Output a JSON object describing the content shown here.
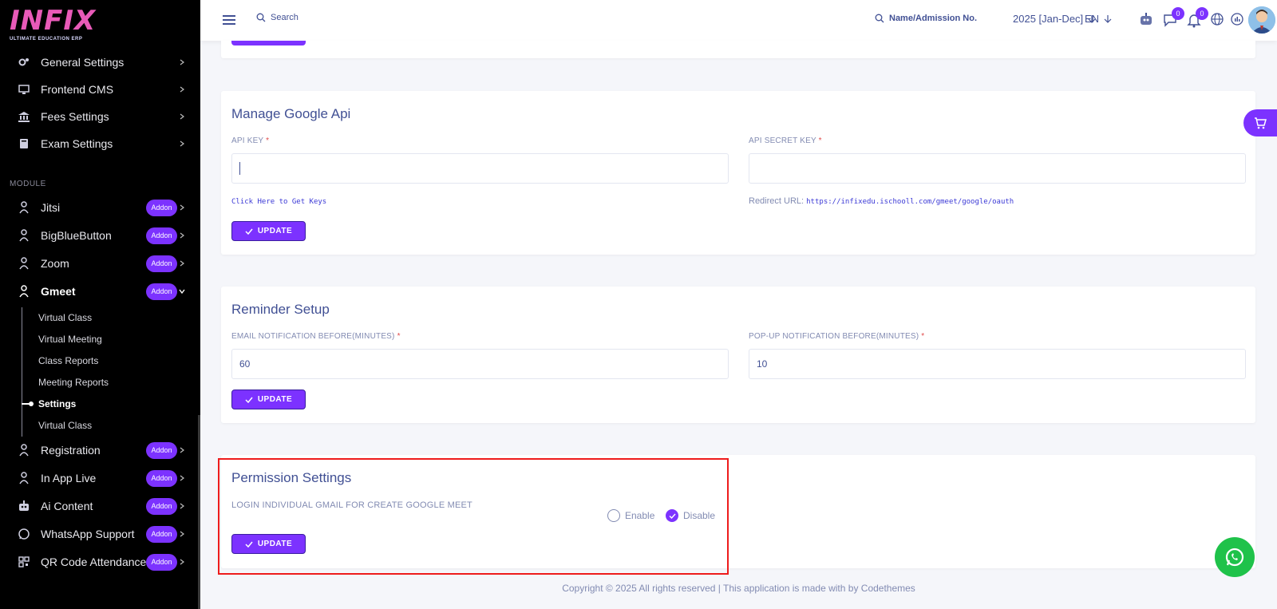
{
  "brand": {
    "logo_text": "INFIX",
    "logo_sub": "ULTIMATE EDUCATION ERP"
  },
  "sidebar": {
    "top_items": [
      {
        "label": "General Settings",
        "icon": "gears-icon"
      },
      {
        "label": "Frontend CMS",
        "icon": "monitor-icon"
      },
      {
        "label": "Fees Settings",
        "icon": "bank-icon"
      },
      {
        "label": "Exam Settings",
        "icon": "book-icon"
      }
    ],
    "module_heading": "MODULE",
    "module_items": [
      {
        "label": "Jitsi",
        "badge": "Addon"
      },
      {
        "label": "BigBlueButton",
        "badge": "Addon"
      },
      {
        "label": "Zoom",
        "badge": "Addon"
      },
      {
        "label": "Gmeet",
        "badge": "Addon"
      }
    ],
    "gmeet_subitems": [
      "Virtual Class",
      "Virtual Meeting",
      "Class Reports",
      "Meeting Reports",
      "Settings",
      "Virtual Class"
    ],
    "active_subitem": "Settings",
    "bottom_items": [
      {
        "label": "Registration",
        "badge": "Addon"
      },
      {
        "label": "In App Live",
        "badge": "Addon"
      },
      {
        "label": "Ai Content",
        "badge": "Addon"
      },
      {
        "label": "WhatsApp Support",
        "badge": "Addon"
      },
      {
        "label": "QR Code Attendance",
        "badge": "Addon"
      }
    ]
  },
  "header": {
    "search_label": "Search",
    "student_search_label": "Name/Admission No.",
    "academic_year": "2025 [Jan-Dec]",
    "language": "EN",
    "messages_count": "0",
    "notifications_count": "0"
  },
  "google_api": {
    "title": "Manage Google Api",
    "api_key_label": "API KEY",
    "api_key_value": "",
    "api_secret_label": "API SECRET KEY",
    "api_secret_value": "",
    "get_keys_link": "Click Here to Get Keys",
    "redirect_label": "Redirect URL:",
    "redirect_url": "https://infixedu.ischooll.com/gmeet/google/oauth",
    "update_label": "UPDATE"
  },
  "reminder": {
    "title": "Reminder Setup",
    "email_label": "EMAIL NOTIFICATION BEFORE(MINUTES)",
    "email_value": "60",
    "popup_label": "POP-UP NOTIFICATION BEFORE(MINUTES)",
    "popup_value": "10",
    "update_label": "UPDATE"
  },
  "permission": {
    "title": "Permission Settings",
    "row_label": "LOGIN INDIVIDUAL GMAIL FOR CREATE GOOGLE MEET",
    "enable_label": "Enable",
    "disable_label": "Disable",
    "selected": "Disable",
    "update_label": "UPDATE"
  },
  "footer": {
    "text": "Copyright © 2025 All rights reserved | This application is made with by Codethemes"
  },
  "colors": {
    "accent": "#7c32ff",
    "sidebar_bg": "#000000",
    "text": "#415094",
    "highlight": "#ee1c1c",
    "whatsapp": "#1fc24a"
  }
}
